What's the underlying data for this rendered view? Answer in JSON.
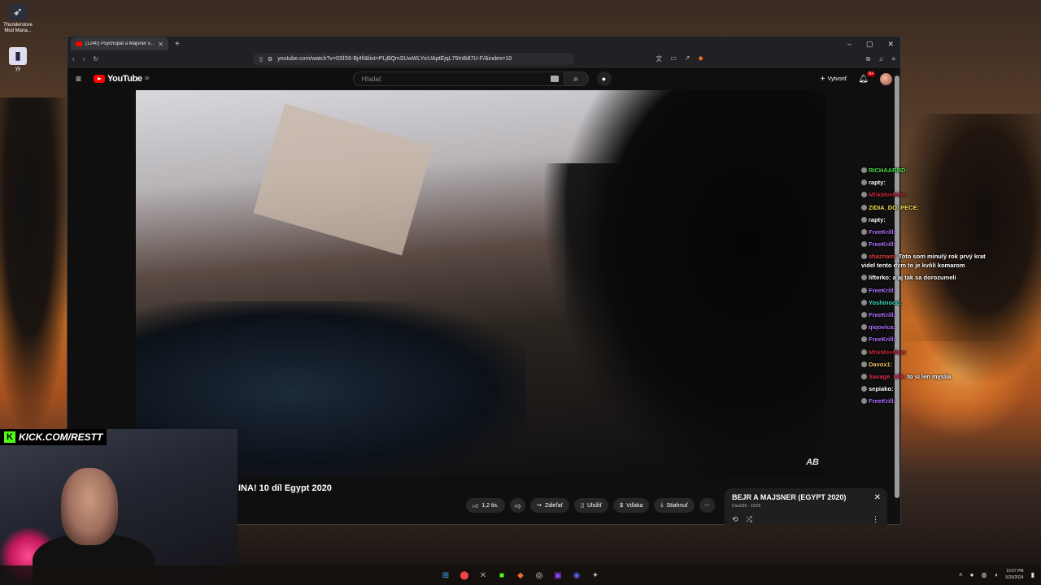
{
  "desktop": {
    "icons": [
      {
        "label": "Thunderstore Mod Mana...",
        "icon": "thunderstore-icon"
      },
      {
        "label": "yy",
        "icon": "file-icon"
      }
    ]
  },
  "browser": {
    "tab_title": "(1240) Psychopat a Majsner v...",
    "url": "youtube.com/watch?v=0SfS6-Bj4fI&list=PLjBQmSUwWLYicUAptEjqL75In8i87U-F/&index=10"
  },
  "youtube": {
    "logo": "YouTube",
    "logo_region": "SK",
    "search_placeholder": "Hľadať",
    "create_label": "Vytvoriť",
    "notifications_badge": "9+"
  },
  "video": {
    "title": "INA! 10 díl Egypt 2020",
    "watermark": "AB",
    "like_count": "1,2 tis.",
    "share_label": "Zdieľať",
    "save_label": "Uložiť",
    "thanks_label": "Vďaka",
    "download_label": "Stiahnuť"
  },
  "playlist": {
    "title": "BEJR A MAJSNER (EGYPT 2020)",
    "subtitle": "David35 - 10/26"
  },
  "chat": [
    {
      "user": "RICHAARRD:",
      "color": "#4ddc4a",
      "msg": ""
    },
    {
      "user": "rapty:",
      "color": "#ffffff",
      "msg": ""
    },
    {
      "user": "MhkMeeMee:",
      "color": "#c0283c",
      "msg": ""
    },
    {
      "user": "ZIDIA_DO_PECE:",
      "color": "#f0e050",
      "msg": ""
    },
    {
      "user": "rapty:",
      "color": "#ffffff",
      "msg": ""
    },
    {
      "user": "FreeKrill:",
      "color": "#b070ff",
      "msg": ""
    },
    {
      "user": "FreeKrill:",
      "color": "#b070ff",
      "msg": ""
    },
    {
      "user": "shaznam:",
      "color": "#e04040",
      "msg": "Toto som minulý rok prvý krat videl tento dym to je kvôli komarom"
    },
    {
      "user": "lifterko:",
      "color": "#ffffff",
      "msg": "a aj tak sa dorozumeli"
    },
    {
      "user": "FreeKrill:",
      "color": "#b070ff",
      "msg": ""
    },
    {
      "user": "Yoshinooo:",
      "color": "#40d8c8",
      "msg": ""
    },
    {
      "user": "FreeKrill:",
      "color": "#b070ff",
      "msg": ""
    },
    {
      "user": "qiqovica:",
      "color": "#b070ff",
      "msg": ""
    },
    {
      "user": "FreeKrill:",
      "color": "#b070ff",
      "msg": ""
    },
    {
      "user": "MhkMeeMee:",
      "color": "#c0283c",
      "msg": ""
    },
    {
      "user": "Davox1:",
      "color": "#f0c060",
      "msg": ""
    },
    {
      "user": "Savage_Mik:",
      "color": "#e03050",
      "msg": "to si len myslia"
    },
    {
      "user": "sepiako:",
      "color": "#ffffff",
      "msg": ""
    },
    {
      "user": "FreeKrill:",
      "color": "#b070ff",
      "msg": ""
    }
  ],
  "webcam": {
    "kick_text": "KICK.COM/RESTT"
  },
  "taskbar": {
    "time": "10:57 PM",
    "date": "5/29/2024"
  }
}
